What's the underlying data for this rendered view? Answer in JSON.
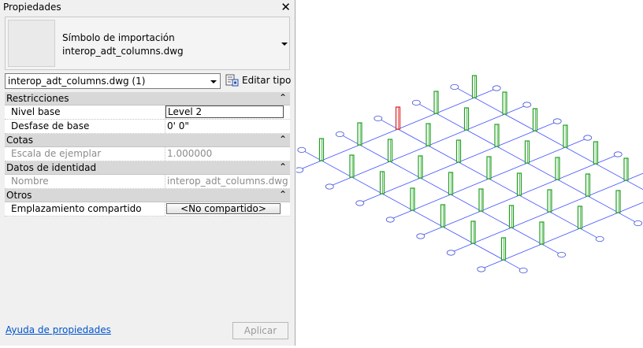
{
  "panel": {
    "title": "Propiedades",
    "close_glyph": "✕"
  },
  "type_selector": {
    "category": "Símbolo de importación",
    "type_name": "interop_adt_columns.dwg"
  },
  "instance": {
    "selected": "interop_adt_columns.dwg (1)",
    "edit_type_label": "Editar tipo",
    "edit_type_icon": "edit-type-icon"
  },
  "sections": [
    {
      "label": "Restricciones",
      "toggle": "⌃",
      "rows": [
        {
          "label": "Nivel base",
          "value": "Level 2"
        },
        {
          "label": "Desfase de base",
          "value": "0'  0\""
        }
      ]
    },
    {
      "label": "Cotas",
      "toggle": "⌃",
      "rows": [
        {
          "label": "Escala de ejemplar",
          "value": "1.000000"
        }
      ]
    },
    {
      "label": "Datos de identidad",
      "toggle": "⌃",
      "rows": [
        {
          "label": "Nombre",
          "value": "interop_adt_columns.dwg"
        }
      ]
    },
    {
      "label": "Otros",
      "toggle": "⌃",
      "rows": [
        {
          "label": "Emplazamiento compartido",
          "value": "<No compartido>"
        }
      ]
    }
  ],
  "footer": {
    "help_link": "Ayuda de propiedades",
    "apply_label": "Aplicar"
  },
  "viewport": {
    "grid_color": "#3f4fff",
    "column_color": "#22a022",
    "selected_column_color": "#d92020",
    "bubble_color": "#4a55d8"
  }
}
